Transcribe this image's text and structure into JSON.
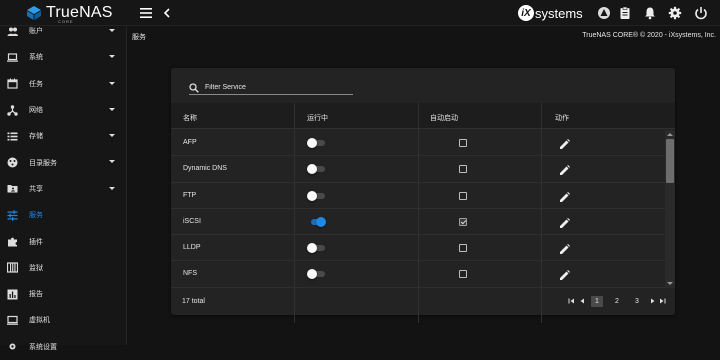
{
  "brand": {
    "name": "TrueNAS",
    "sub": "CORE"
  },
  "topbar": {
    "vendor_badge": "iX",
    "vendor_text": "systems"
  },
  "sidebar": {
    "items": [
      {
        "label": "账户",
        "icon": "people-icon",
        "has_caret": true
      },
      {
        "label": "系统",
        "icon": "laptop-icon",
        "has_caret": true
      },
      {
        "label": "任务",
        "icon": "calendar-icon",
        "has_caret": true
      },
      {
        "label": "网络",
        "icon": "network-icon",
        "has_caret": true
      },
      {
        "label": "存储",
        "icon": "list-icon",
        "has_caret": true
      },
      {
        "label": "目录服务",
        "icon": "directory-icon",
        "has_caret": true
      },
      {
        "label": "共享",
        "icon": "folder-share-icon",
        "has_caret": true
      },
      {
        "label": "服务",
        "icon": "tune-icon",
        "has_caret": false,
        "active": true
      },
      {
        "label": "插件",
        "icon": "puzzle-icon",
        "has_caret": false
      },
      {
        "label": "监狱",
        "icon": "jail-icon",
        "has_caret": false
      },
      {
        "label": "报告",
        "icon": "chart-icon",
        "has_caret": false
      },
      {
        "label": "虚拟机",
        "icon": "computer-icon",
        "has_caret": false
      },
      {
        "label": "系统设置",
        "icon": "settings-icon",
        "has_caret": false
      }
    ]
  },
  "header": {
    "breadcrumb": "服务",
    "copyright": "TrueNAS CORE® © 2020 - iXsystems, Inc."
  },
  "filter": {
    "placeholder": "Filter Service"
  },
  "table": {
    "columns": [
      "名称",
      "运行中",
      "自动启动",
      "动作"
    ],
    "rows": [
      {
        "name": "AFP",
        "running": false,
        "autostart": false
      },
      {
        "name": "Dynamic DNS",
        "running": false,
        "autostart": false
      },
      {
        "name": "FTP",
        "running": false,
        "autostart": false
      },
      {
        "name": "iSCSI",
        "running": true,
        "autostart": true
      },
      {
        "name": "LLDP",
        "running": false,
        "autostart": false
      },
      {
        "name": "NFS",
        "running": false,
        "autostart": false
      }
    ]
  },
  "footer": {
    "total": "17 total",
    "pages": [
      "1",
      "2",
      "3"
    ],
    "current_page": "1"
  },
  "colors": {
    "accent": "#1e88e5",
    "background": "#131313",
    "card": "#232323"
  }
}
